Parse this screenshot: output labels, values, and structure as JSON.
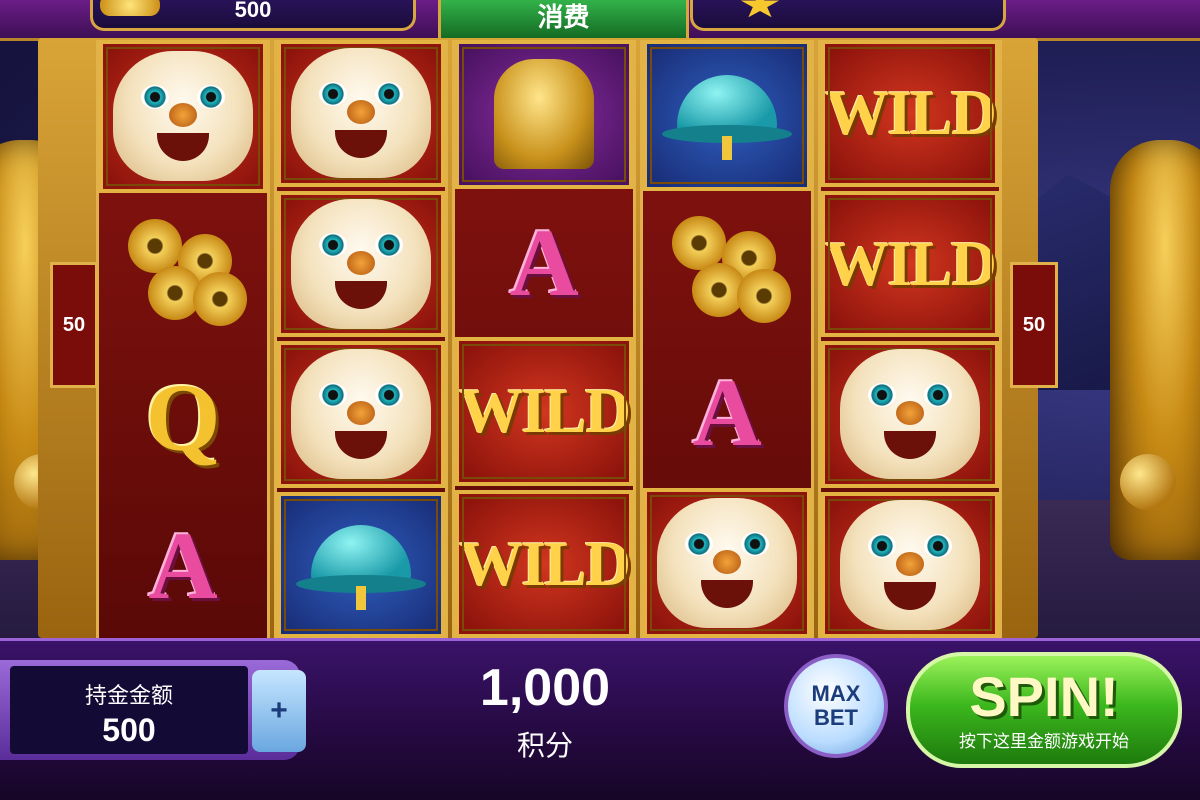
{
  "top_bar": {
    "left_value": "500",
    "center_label": "消费"
  },
  "paylines": {
    "left": "50",
    "right": "50"
  },
  "reels": [
    [
      "lion",
      "coins",
      "Q",
      "A"
    ],
    [
      "lion",
      "lion",
      "lion",
      "hat"
    ],
    [
      "statue",
      "A",
      "WILD",
      "WILD"
    ],
    [
      "hat",
      "coins",
      "A",
      "lion"
    ],
    [
      "WILD",
      "WILD",
      "lion",
      "lion"
    ]
  ],
  "bottom_bar": {
    "bet_label": "持金金额",
    "bet_value": "500",
    "plus_label": "+",
    "credit_value": "1,000",
    "credit_label": "积分",
    "max_bet_label": "MAX BET",
    "spin_label": "SPIN!",
    "spin_sublabel": "按下这里金额游戏开始"
  }
}
